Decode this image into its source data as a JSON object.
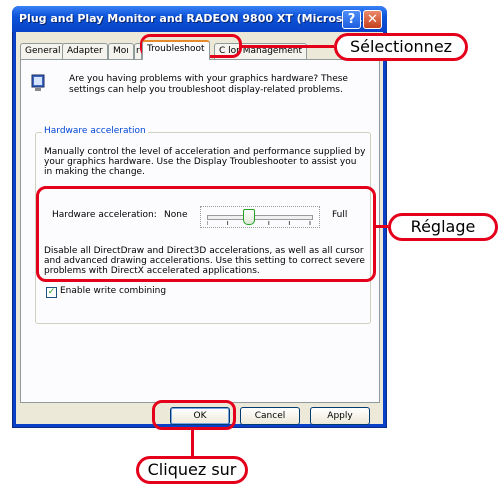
{
  "window": {
    "title": "Plug and Play Monitor and RADEON 9800 XT (Microso...",
    "help_button": "?",
    "close_button": "✕"
  },
  "tabs": [
    "General",
    "Adapter",
    "Mor",
    "Troubleshoot",
    "Color Management"
  ],
  "tabs_visible": {
    "general": "General",
    "adapter": "Adapter",
    "monitor_partial": "Moı",
    "troubleshoot": "Troubleshoot",
    "color_partial_left": "r",
    "color_partial_right": "C  lor Management"
  },
  "intro": "Are you having problems with your graphics hardware? These settings can help you troubleshoot display-related problems.",
  "group": {
    "label": "Hardware acceleration",
    "description": "Manually control the level of acceleration and performance supplied by your graphics hardware. Use the Display Troubleshooter to assist you in making the change.",
    "slider_label": "Hardware acceleration:",
    "min_label": "None",
    "max_label": "Full",
    "slider_level": 0.4,
    "disable_text": "Disable all DirectDraw and Direct3D accelerations, as well as all cursor and advanced drawing accelerations. Use this setting to correct severe problems with DirectX accelerated applications.",
    "checkbox_label": "Enable write combining",
    "checkbox_checked": true
  },
  "buttons": {
    "ok": "OK",
    "cancel": "Cancel",
    "apply": "Apply"
  },
  "callouts": {
    "select": "Sélectionnez",
    "adjust": "Réglage",
    "click": "Cliquez sur"
  },
  "colors": {
    "accent": "#e4001b",
    "titlebar": "#0c53d8",
    "dialog": "#ece9d8"
  }
}
